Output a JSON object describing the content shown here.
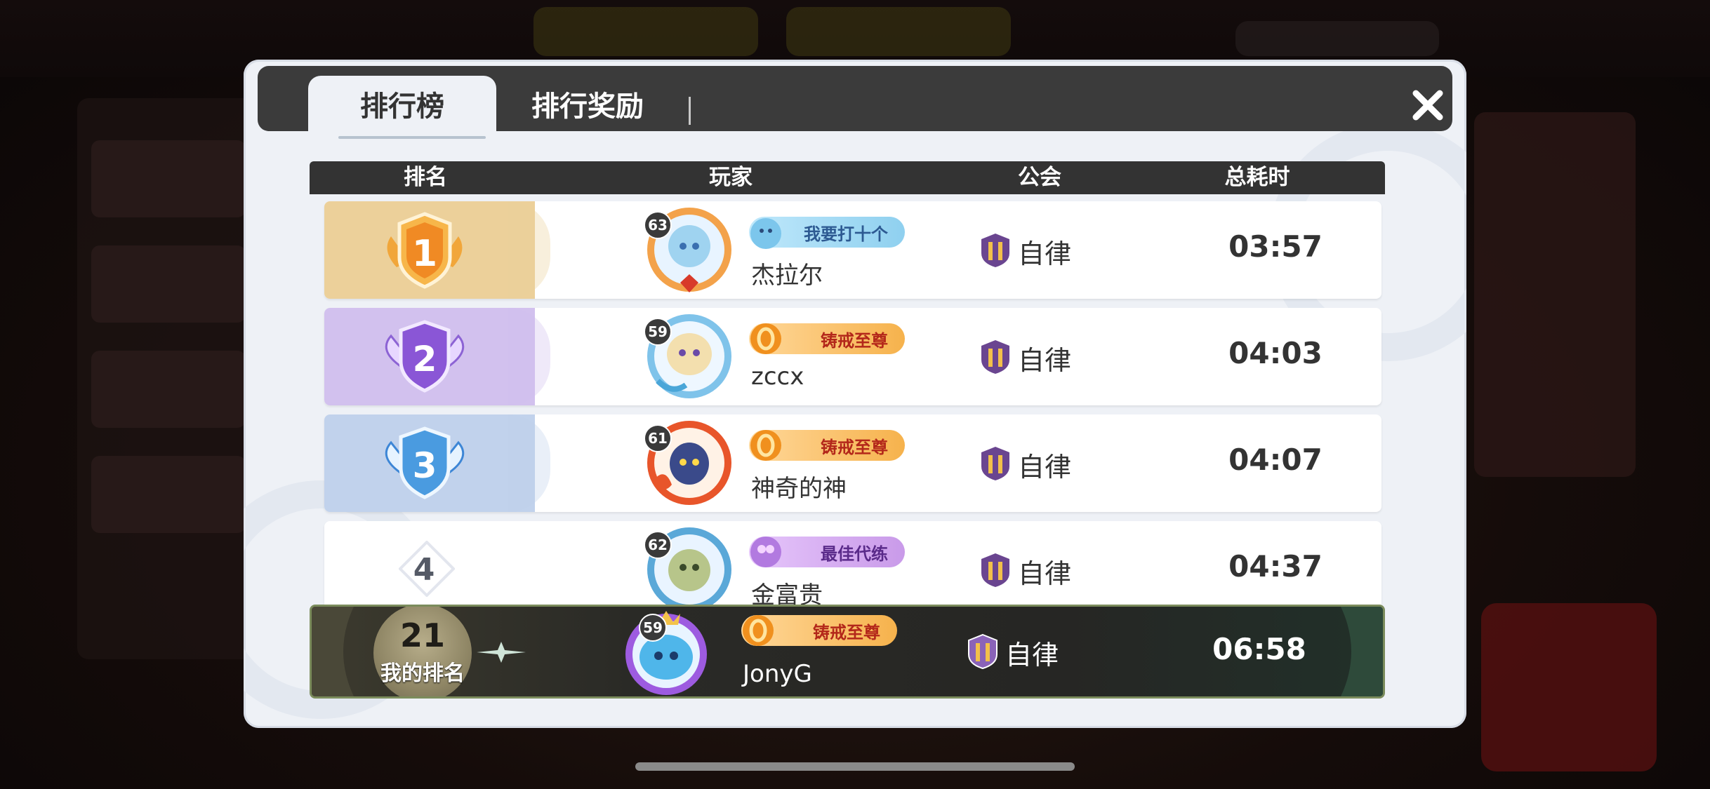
{
  "tabs": {
    "leaderboard": "排行榜",
    "rewards": "排行奖励"
  },
  "table": {
    "headers": {
      "rank": "排名",
      "player": "玩家",
      "guild": "公会",
      "time": "总耗时"
    },
    "rows": [
      {
        "rank": "1",
        "level": "63",
        "title": "我要打十个",
        "title_style": "blue",
        "name": "杰拉尔",
        "guild": "自律",
        "time": "03:57"
      },
      {
        "rank": "2",
        "level": "59",
        "title": "铸戒至尊",
        "title_style": "gold",
        "name": "zccx",
        "guild": "自律",
        "time": "04:03"
      },
      {
        "rank": "3",
        "level": "61",
        "title": "铸戒至尊",
        "title_style": "gold",
        "name": "神奇的神",
        "guild": "自律",
        "time": "04:07"
      },
      {
        "rank": "4",
        "level": "62",
        "title": "最佳代练",
        "title_style": "purple",
        "name": "金富贵",
        "guild": "自律",
        "time": "04:37"
      }
    ]
  },
  "my_rank": {
    "rank": "21",
    "label": "我的排名",
    "level": "59",
    "title": "铸戒至尊",
    "name": "JonyG",
    "guild": "自律",
    "time": "06:58"
  },
  "colors": {
    "rank1": "#e9c98a",
    "rank2": "#c9b6e8",
    "rank3": "#b9cbe8",
    "title_blue": "#8fd0ef",
    "title_gold": "#f0a437",
    "title_purple": "#c99ae9"
  },
  "icons": [
    "close-icon",
    "rank-1-medal-icon",
    "rank-2-medal-icon",
    "rank-3-medal-icon",
    "guild-shield-icon"
  ]
}
